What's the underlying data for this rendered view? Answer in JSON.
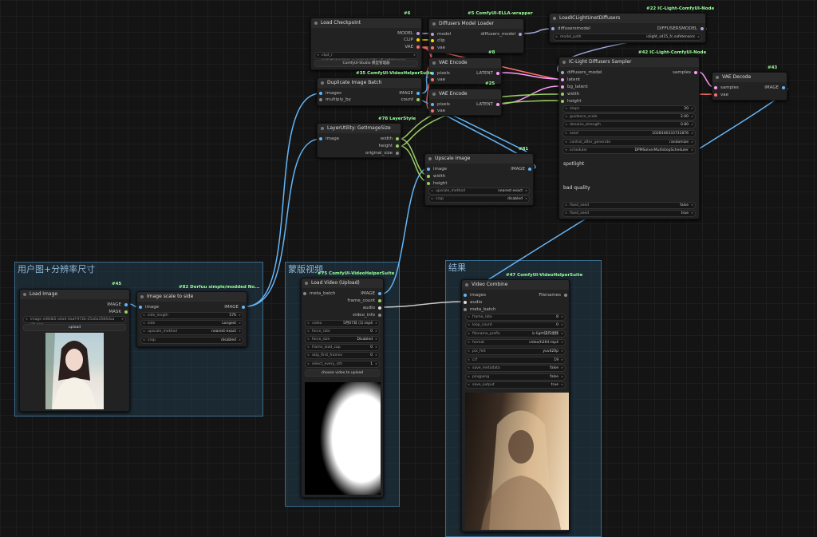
{
  "groups": {
    "g1": "用户图+分辨率尺寸",
    "g2": "蒙版视频",
    "g3": "结果"
  },
  "badges": {
    "n6": "#6",
    "n5": "#5 ComfyUI-ELLA-wrapper",
    "n22": "#22 IC-Light-ComfyUI-Node",
    "n35": "#35 ComfyUI-VideoHelperSuite",
    "n8": "#8",
    "n25": "#25",
    "n42": "#42 IC-Light-ComfyUI-Node",
    "n43": "#43",
    "n78": "#78 LayerStyle",
    "n81": "#81",
    "n45": "#45",
    "n82": "#82 Derfuu simple/modded No...",
    "n75": "#75 ComfyUI-VideoHelperSuite",
    "n47": "#47 ComfyUI-VideoHelperSuite"
  },
  "nodes": {
    "load_checkpoint": {
      "title": "Load Checkpoint",
      "outputs": [
        "MODEL",
        "CLIP",
        "VAE"
      ],
      "ckpt": "ckpt_r realistic/realism_pure/realvisXL_v5.safetensors",
      "button": "ComfyUI-Studio 模型管理器"
    },
    "diffusers_loader": {
      "title": "Diffusers Model Loader",
      "inputs": [
        "model",
        "clip",
        "vae"
      ],
      "output": "diffusers_model"
    },
    "load_iclight": {
      "title": "LoadICLightUnetDiffusers",
      "input": "diffusersmodel",
      "output": "DIFFUSERSMODEL",
      "model_path_label": "model_path",
      "model_path_value": "iclight_sd15_fc.safetensors"
    },
    "vae_encode_1": {
      "title": "VAE Encode",
      "inputs": [
        "pixels",
        "vae"
      ],
      "output": "LATENT"
    },
    "vae_encode_2": {
      "title": "VAE Encode",
      "inputs": [
        "pixels",
        "vae"
      ],
      "output": "LATENT"
    },
    "dup_batch": {
      "title": "Duplicate Image Batch",
      "inputs": [
        "images",
        "multiply_by"
      ],
      "outputs": [
        "IMAGE",
        "count"
      ]
    },
    "sampler": {
      "title": "IC-Light Diffusers Sampler",
      "inputs": [
        "diffusers_model",
        "latent",
        "bg_latent",
        "width",
        "height"
      ],
      "output": "samples",
      "widgets": [
        {
          "label": "steps",
          "value": "20"
        },
        {
          "label": "guidance_scale",
          "value": "2.00"
        },
        {
          "label": "denoise_strength",
          "value": "0.80"
        },
        {
          "label": "seed",
          "value": "1028346333731876"
        },
        {
          "label": "control_after_generate",
          "value": "randomize"
        },
        {
          "label": "scheduler",
          "value": "DPMSolverMultistepScheduler"
        }
      ],
      "prompt": "spotlight",
      "negative": "bad quality",
      "toggles": [
        {
          "label": "fixed_seed",
          "value": "false"
        },
        {
          "label": "fixed_seed",
          "value": "true"
        }
      ]
    },
    "vae_decode": {
      "title": "VAE Decode",
      "inputs": [
        "samples",
        "vae"
      ],
      "output": "IMAGE"
    },
    "get_image_size": {
      "title": "LayerUtility: GetImageSize",
      "input": "image",
      "outputs": [
        "width",
        "height",
        "original_size"
      ]
    },
    "upscale": {
      "title": "Upscale Image",
      "inputs": [
        "image",
        "width",
        "height"
      ],
      "output": "IMAGE",
      "widgets": [
        {
          "label": "upscale_method",
          "value": "nearest-exact"
        },
        {
          "label": "crop",
          "value": "disabled"
        }
      ]
    },
    "load_image": {
      "title": "Load Image",
      "outputs": [
        "IMAGE",
        "MASK"
      ],
      "file": "image  e48db5-a4a4-4aaf-972b-25a0a3584daa (2).png",
      "button": "upload"
    },
    "image_scale": {
      "title": "Image scale to side",
      "input": "image",
      "output": "IMAGE",
      "widgets": [
        {
          "label": "side_length",
          "value": "576"
        },
        {
          "label": "side",
          "value": "Longest"
        },
        {
          "label": "upscale_method",
          "value": "nearest-exact"
        },
        {
          "label": "crop",
          "value": "disabled"
        }
      ]
    },
    "load_video": {
      "title": "Load Video (Upload)",
      "input": "meta_batch",
      "outputs": [
        "IMAGE",
        "frame_count",
        "audio",
        "video_info"
      ],
      "widgets": [
        {
          "label": "video",
          "value": "5月07日 (1).mp4"
        },
        {
          "label": "force_rate",
          "value": "0"
        },
        {
          "label": "force_size",
          "value": "Disabled"
        },
        {
          "label": "frame_load_cap",
          "value": "0"
        },
        {
          "label": "skip_first_frames",
          "value": "0"
        },
        {
          "label": "select_every_nth",
          "value": "1"
        }
      ],
      "button": "choose video to upload"
    },
    "video_combine": {
      "title": "Video Combine",
      "inputs": [
        "images",
        "audio",
        "meta_batch"
      ],
      "output": "Filenames",
      "widgets": [
        {
          "label": "frame_rate",
          "value": "8"
        },
        {
          "label": "loop_count",
          "value": "0"
        },
        {
          "label": "filename_prefix",
          "value": "ic-light操作视频"
        },
        {
          "label": "format",
          "value": "video/h264-mp4"
        },
        {
          "label": "pix_fmt",
          "value": "yuv420p"
        },
        {
          "label": "crf",
          "value": "19"
        },
        {
          "label": "save_metadata",
          "value": "false"
        },
        {
          "label": "pingpong",
          "value": "false"
        },
        {
          "label": "save_output",
          "value": "true"
        }
      ]
    }
  },
  "colors": {
    "model": "#b39ddb",
    "clip": "#ffd500",
    "vae": "#ff6e6e",
    "latent": "#ff9cf9",
    "image": "#64b5f6",
    "int": "#9ccc65"
  }
}
